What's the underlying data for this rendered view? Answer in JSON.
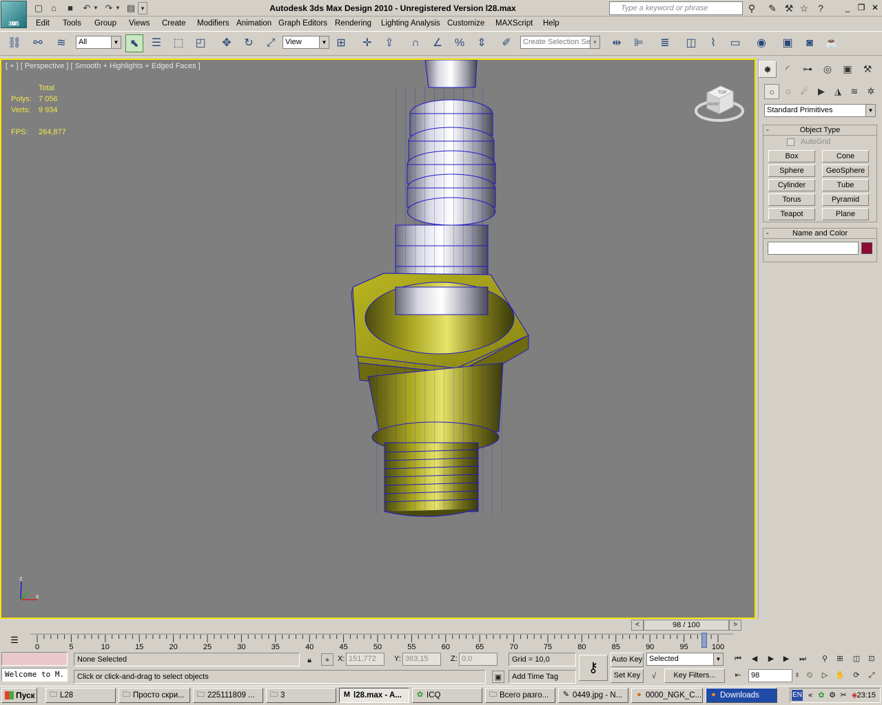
{
  "app": {
    "logo_text": "M",
    "logo_sub": "3DS",
    "window_title": "Autodesk 3ds Max Design 2010   -  Unregistered Version      l28.max",
    "search_placeholder": "Type a keyword or phrase"
  },
  "menubar": [
    "Edit",
    "Tools",
    "Group",
    "Views",
    "Create",
    "Modifiers",
    "Animation",
    "Graph Editors",
    "Rendering",
    "Lighting Analysis",
    "Customize",
    "MAXScript",
    "Help"
  ],
  "toolbar": {
    "selection_filter": "All",
    "reference_coord": "View",
    "named_selection_placeholder": "Create Selection Se"
  },
  "viewport": {
    "label": "[ + ] [ Perspective ] [ Smooth + Highlights + Edged Faces ]",
    "stats_header": "Total",
    "polys_label": "Polys:",
    "polys_value": "7 056",
    "verts_label": "Verts:",
    "verts_value": "9 934",
    "fps_label": "FPS:",
    "fps_value": "264,877",
    "viewcube_top": "TOP",
    "viewcube_front": "FRONT",
    "axis_z": "z",
    "axis_x": "x",
    "colors": {
      "background": "#7f7f7f",
      "border": "#f5e600",
      "stats": "#f2e84a",
      "wire": "#2018c8",
      "nut": "#a8a414"
    }
  },
  "command_panel": {
    "category_dropdown": "Standard Primitives",
    "object_type_title": "Object Type",
    "autogrid_label": "AutoGrid",
    "buttons": [
      "Box",
      "Cone",
      "Sphere",
      "GeoSphere",
      "Cylinder",
      "Tube",
      "Torus",
      "Pyramid",
      "Teapot",
      "Plane"
    ],
    "name_color_title": "Name and Color",
    "object_color": "#8e0a36"
  },
  "timeslider": {
    "position_label": "98 / 100",
    "prev": "<",
    "next": ">",
    "ticks": [
      "0",
      "5",
      "10",
      "15",
      "20",
      "25",
      "30",
      "35",
      "40",
      "45",
      "50",
      "55",
      "60",
      "65",
      "70",
      "75",
      "80",
      "85",
      "90",
      "95",
      "100"
    ]
  },
  "status": {
    "maxscript_text": "Welcome to M.",
    "selection_text": "None Selected",
    "prompt_text": "Click or click-and-drag to select objects",
    "x_label": "X:",
    "x_value": "151,772",
    "y_label": "Y:",
    "y_value": "363,15",
    "z_label": "Z:",
    "z_value": "0,0",
    "grid_text": "Grid = 10,0",
    "add_time_tag": "Add Time Tag",
    "auto_key": "Auto Key",
    "set_key": "Set Key",
    "key_mode_dropdown": "Selected",
    "key_filters": "Key Filters...",
    "current_frame": "98"
  },
  "taskbar": {
    "start_label": "Пуск",
    "items": [
      "L28",
      "Просто скри...",
      "225111809 ...",
      "3",
      "l28.max - A...",
      "ICQ",
      "Всего разго...",
      "0449.jpg - N...",
      "0000_NGK_C...",
      "Downloads"
    ],
    "lang": "EN",
    "clock": "23:15"
  }
}
